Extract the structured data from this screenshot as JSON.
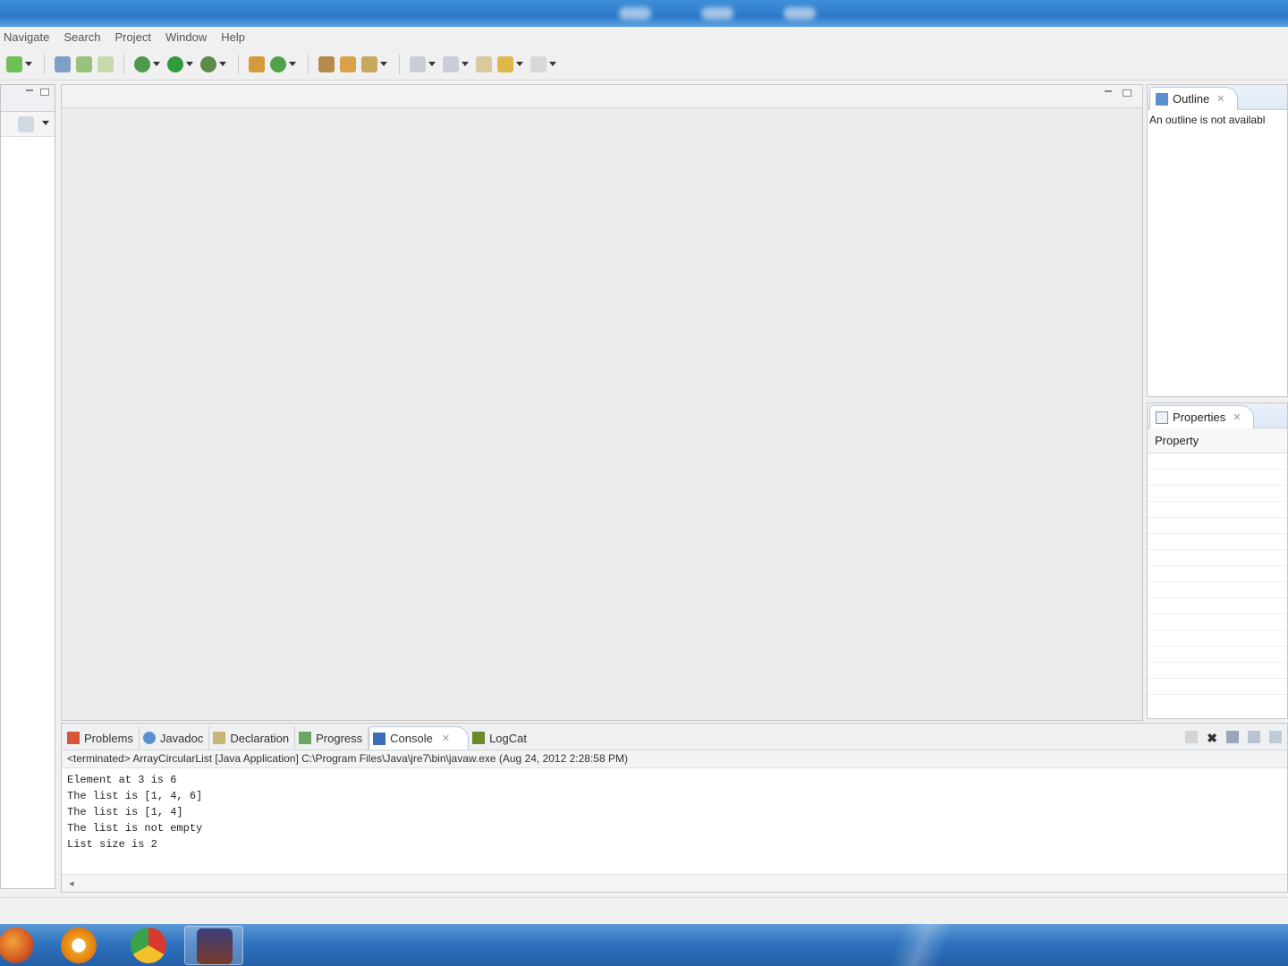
{
  "menu": [
    "Navigate",
    "Search",
    "Project",
    "Window",
    "Help"
  ],
  "outline": {
    "tab_label": "Outline",
    "message": "An outline is not availabl"
  },
  "properties": {
    "tab_label": "Properties",
    "column_header": "Property"
  },
  "bottom_tabs": [
    "Problems",
    "Javadoc",
    "Declaration",
    "Progress",
    "Console",
    "LogCat"
  ],
  "console": {
    "description": "<terminated> ArrayCircularList [Java Application] C:\\Program Files\\Java\\jre7\\bin\\javaw.exe (Aug 24, 2012 2:28:58 PM)",
    "lines": [
      "Element at 3 is 6",
      "The list is [1, 4, 6]",
      "The list is [1, 4]",
      "The list is not empty",
      "List size is 2"
    ]
  },
  "colors": {
    "taskbar": "#2f73bf",
    "window_bg": "#f0f0f0",
    "tab_active_border": "#b9c8dc"
  },
  "icons": {
    "taskbar": [
      "firefox-icon",
      "media-player-icon",
      "chrome-icon",
      "eclipse-app-icon"
    ]
  }
}
